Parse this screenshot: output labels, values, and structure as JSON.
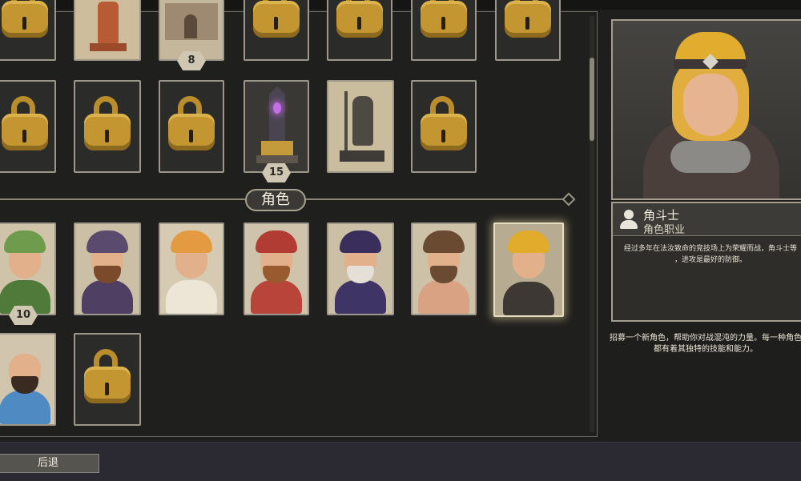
{
  "section": {
    "title": "角色"
  },
  "buttons": {
    "back": "后退"
  },
  "structures": {
    "row1_badge": "8",
    "row2_badge": "15"
  },
  "characters": {
    "first_badge": "10",
    "selected_index": 6
  },
  "detail": {
    "name": "角斗士",
    "class_label": "角色职业",
    "description": "经过多年在法汝致命的竞技场上为荣耀而战，角斗士等",
    "description_2": "，进攻是最好的防御。"
  },
  "recruit": {
    "line1": "招募一个新角色，帮助你对战混沌的力量。每一种角色",
    "line2": "都有着其独特的技能和能力。"
  },
  "colors": {
    "background": "#1e1e1c",
    "card_border": "#9c978a",
    "lock_gold": "#c49632",
    "selected_glow": "#ffe8aa"
  }
}
